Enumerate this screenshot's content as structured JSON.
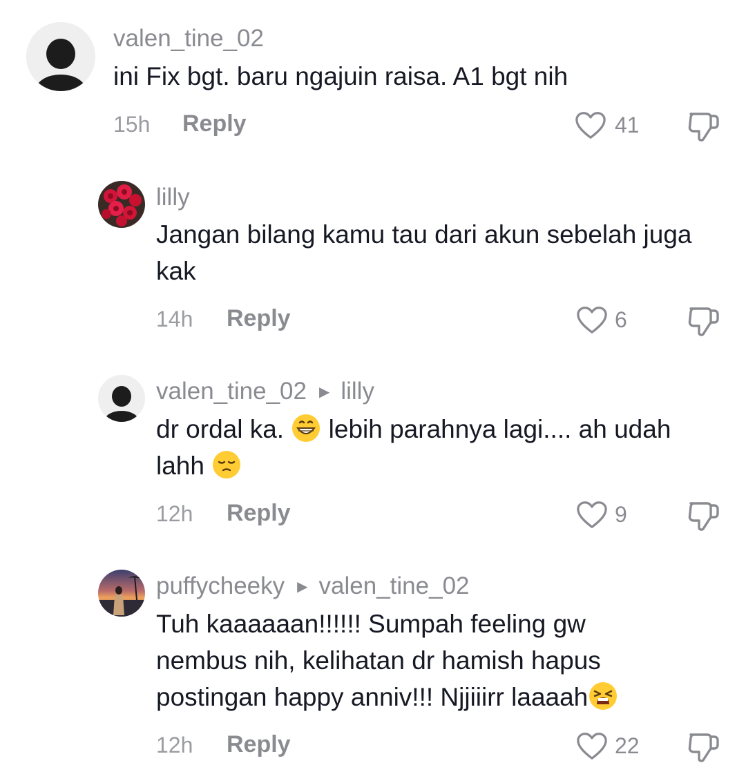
{
  "comments": [
    {
      "username": "valen_tine_02",
      "reply_to": "",
      "text": "ini Fix bgt. baru ngajuin raisa. A1 bgt nih",
      "time": "15h",
      "reply_label": "Reply",
      "likes": "41",
      "avatar": "dark-silhouette"
    },
    {
      "username": "lilly",
      "reply_to": "",
      "text": "Jangan bilang kamu tau dari akun sebelah juga kak",
      "time": "14h",
      "reply_label": "Reply",
      "likes": "6",
      "avatar": "red-roses"
    },
    {
      "username": "valen_tine_02",
      "reply_to": "lilly",
      "text_part1": "dr ordal ka. ",
      "emoji1": "grinning-face",
      "text_part2": " lebih parahnya lagi.... ah udah lahh ",
      "emoji2": "pensive-face",
      "time": "12h",
      "reply_label": "Reply",
      "likes": "9",
      "avatar": "dark-silhouette"
    },
    {
      "username": "puffycheeky",
      "reply_to": "valen_tine_02",
      "text": "Tuh kaaaaaan!!!!!! Sumpah feeling gw nembus nih, kelihatan dr hamish hapus postingan happy anniv!!! Njjiiirr laaaah",
      "emoji": "weary-face",
      "time": "12h",
      "reply_label": "Reply",
      "likes": "22",
      "avatar": "sunset-beach-photo"
    }
  ],
  "icons": {
    "like": "heart-outline-icon",
    "dislike": "thumbs-down-icon",
    "reply_arrow": "caret-right-icon"
  }
}
